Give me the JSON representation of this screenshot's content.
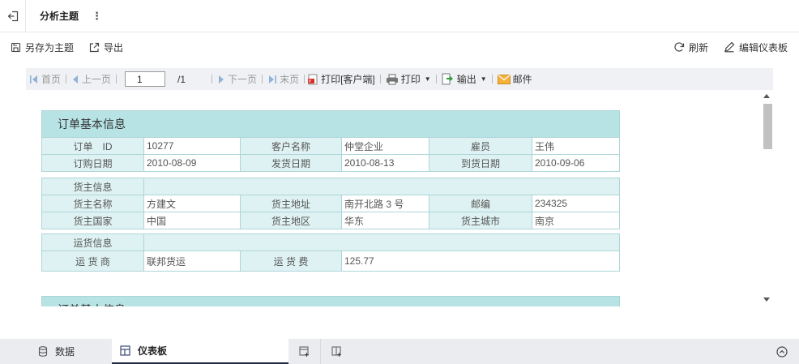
{
  "header": {
    "title": "分析主题"
  },
  "actions": {
    "save_as": "另存为主题",
    "export": "导出",
    "refresh": "刷新",
    "edit_dashboard": "编辑仪表板"
  },
  "toolbar": {
    "first": "首页",
    "prev": "上一页",
    "page_value": "1",
    "page_total": "/1",
    "next": "下一页",
    "last": "末页",
    "print_client": "打印[客户端]",
    "print": "打印",
    "output": "输出",
    "mail": "邮件"
  },
  "report": {
    "order_title": "订单基本信息",
    "order_rows": [
      [
        "订单　ID",
        "10277",
        "客户名称",
        "仲堂企业",
        "雇员",
        "王伟"
      ],
      [
        "订购日期",
        "2010-08-09",
        "发货日期",
        "2010-08-13",
        "到货日期",
        "2010-09-06"
      ]
    ],
    "shipper_title": "货主信息",
    "shipper_rows": [
      [
        "货主名称",
        "方建文",
        "货主地址",
        "南开北路 3 号",
        "邮编",
        "234325"
      ],
      [
        "货主国家",
        "中国",
        "货主地区",
        "华东",
        "货主城市",
        "南京"
      ]
    ],
    "freight_title": "运货信息",
    "freight_row": [
      "运 货 商",
      "联邦货运",
      "运 货 费",
      "125.77"
    ],
    "next_section_title": "订单基本信息"
  },
  "bottom_tabs": {
    "data": "数据",
    "dashboard": "仪表板"
  },
  "colors": {
    "header_bg": "#b7e3e5",
    "label_bg": "#dff2f3",
    "border": "#aed5d9",
    "active_tab_border": "#1f2a44"
  }
}
